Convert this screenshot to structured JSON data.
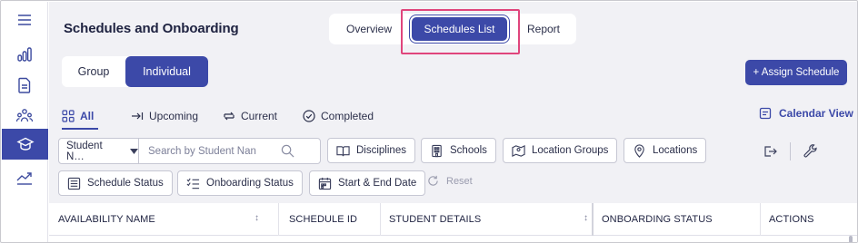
{
  "sidebar": {
    "items": [
      {
        "icon": "hamburger-menu-icon"
      },
      {
        "icon": "bar-chart-icon"
      },
      {
        "icon": "document-icon"
      },
      {
        "icon": "people-group-icon"
      },
      {
        "icon": "graduation-cap-icon",
        "active": true
      },
      {
        "icon": "trend-line-icon"
      }
    ]
  },
  "header": {
    "title": "Schedules and Onboarding",
    "tabs": [
      {
        "label": "Overview"
      },
      {
        "label": "Schedules List",
        "active": true
      },
      {
        "label": "Report"
      }
    ]
  },
  "view_toggle": {
    "group_label": "Group",
    "individual_label": "Individual",
    "active": "Individual"
  },
  "assign_button": {
    "label": "+ Assign Schedule"
  },
  "status_tabs": [
    {
      "label": "All",
      "icon": "grid-icon",
      "active": true
    },
    {
      "label": "Upcoming",
      "icon": "arrow-to-line-icon"
    },
    {
      "label": "Current",
      "icon": "cycle-arrows-icon"
    },
    {
      "label": "Completed",
      "icon": "check-circle-icon"
    }
  ],
  "calendar_view": {
    "label": "Calendar View"
  },
  "search": {
    "select_value": "Student N…",
    "placeholder": "Search by Student Nan"
  },
  "filters": {
    "disciplines": "Disciplines",
    "schools": "Schools",
    "location_groups": "Location Groups",
    "locations": "Locations",
    "schedule_status": "Schedule Status",
    "onboarding_status": "Onboarding Status",
    "start_end_date": "Start & End Date",
    "reset": "Reset"
  },
  "table": {
    "columns": [
      {
        "label": "AVAILABILITY NAME",
        "sortable": true
      },
      {
        "label": "SCHEDULE ID",
        "sortable": false
      },
      {
        "label": "STUDENT DETAILS",
        "sortable": true
      },
      {
        "label": "ONBOARDING STATUS",
        "sortable": false
      },
      {
        "label": "ACTIONS",
        "sortable": false
      }
    ],
    "sort_glyph": "↕"
  },
  "colors": {
    "accent": "#3c49a8",
    "highlight": "#e0457c",
    "background": "#f1f1f5"
  }
}
